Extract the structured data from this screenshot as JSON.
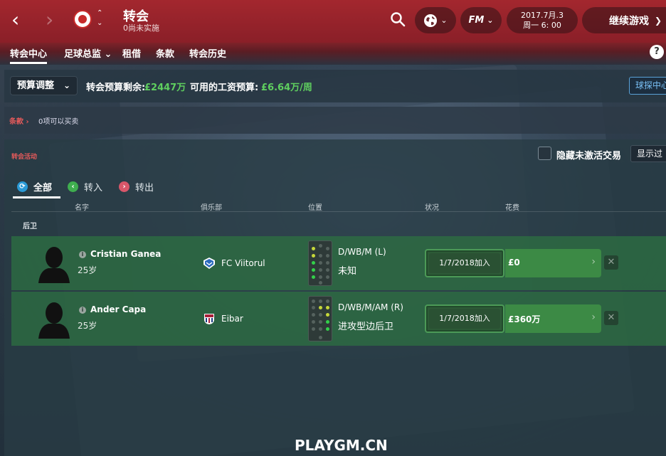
{
  "header": {
    "title": "转会",
    "subtitle": "0尚未实施",
    "date_line1": "2017.7月.3",
    "date_line2": "周一 6: 00",
    "fm_label": "FM",
    "continue_label": "继续游戏"
  },
  "tabs": [
    {
      "label": "转会中心",
      "active": true
    },
    {
      "label": "足球总监 ⌄",
      "active": false
    },
    {
      "label": "租借",
      "active": false
    },
    {
      "label": "条款",
      "active": false
    },
    {
      "label": "转会历史",
      "active": false
    }
  ],
  "budget": {
    "select_label": "预算调整",
    "transfer_label": "转会预算剩余:",
    "transfer_value": "£2447万",
    "wage_label": "可用的工资预算:",
    "wage_value": "£6.64万/周",
    "scout_button": "球探中心"
  },
  "clauses": {
    "label": "条款 ›",
    "text": "0项可以买卖"
  },
  "activity": {
    "title": "转会活动",
    "hide_label": "隐藏未激活交易",
    "show_button": "显示过",
    "filter_tabs": [
      {
        "label": "全部",
        "color": "#2a9ad6",
        "glyph": "⟳"
      },
      {
        "label": "转入",
        "color": "#3fae4f",
        "glyph": "‹"
      },
      {
        "label": "转出",
        "color": "#d9576a",
        "glyph": "›"
      }
    ],
    "columns": {
      "name": "名字",
      "club": "俱乐部",
      "position": "位置",
      "status": "状况",
      "fee": "花费"
    },
    "section": "后卫",
    "rows": [
      {
        "name": "Cristian Ganea",
        "age": "25岁",
        "club": "FC Viitorul",
        "position": "D/WB/M (L)",
        "role": "未知",
        "status": "1/7/2018加入",
        "fee": "£0"
      },
      {
        "name": "Ander Capa",
        "age": "25岁",
        "club": "Eibar",
        "position": "D/WB/M/AM (R)",
        "role": "进攻型边后卫",
        "status": "1/7/2018加入",
        "fee": "£360万"
      }
    ]
  },
  "watermark": "PLAYGM.CN",
  "colors": {
    "header_red": "#a3272e",
    "row_green": "#2d6e41",
    "money_green": "#5fcf5f",
    "accent_red": "#e55a5a"
  }
}
